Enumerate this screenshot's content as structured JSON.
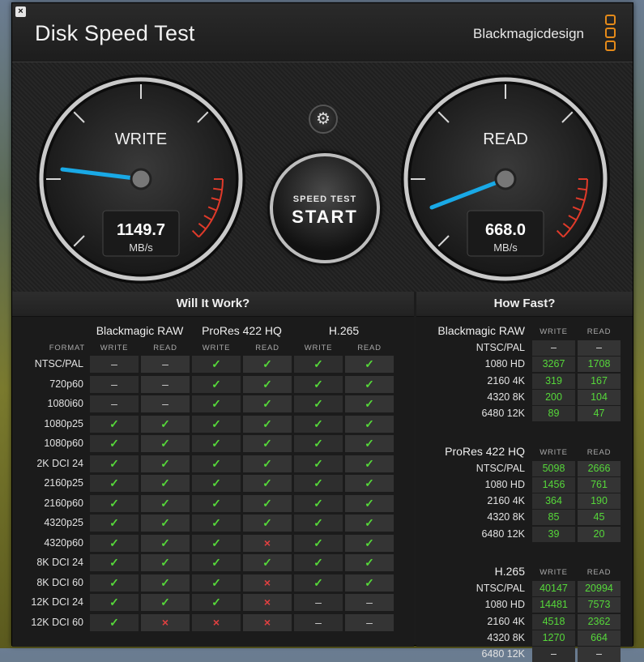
{
  "window": {
    "title": "Disk Speed Test",
    "brand": "Blackmagicdesign",
    "close_glyph": "×"
  },
  "write_gauge": {
    "label": "WRITE",
    "value": "1149.7",
    "unit": "MB/s"
  },
  "read_gauge": {
    "label": "READ",
    "value": "668.0",
    "unit": "MB/s"
  },
  "start_button": {
    "subtitle": "SPEED TEST",
    "label": "START"
  },
  "settings_icon": "gear-icon",
  "will_it_work": {
    "title": "Will It Work?",
    "format_label": "FORMAT",
    "write_label": "WRITE",
    "read_label": "READ",
    "groups": [
      "Blackmagic RAW",
      "ProRes 422 HQ",
      "H.265"
    ],
    "rows": [
      {
        "format": "NTSC/PAL",
        "marks": [
          "–",
          "–",
          "✓",
          "✓",
          "✓",
          "✓"
        ]
      },
      {
        "format": "720p60",
        "marks": [
          "–",
          "–",
          "✓",
          "✓",
          "✓",
          "✓"
        ]
      },
      {
        "format": "1080i60",
        "marks": [
          "–",
          "–",
          "✓",
          "✓",
          "✓",
          "✓"
        ]
      },
      {
        "format": "1080p25",
        "marks": [
          "✓",
          "✓",
          "✓",
          "✓",
          "✓",
          "✓"
        ]
      },
      {
        "format": "1080p60",
        "marks": [
          "✓",
          "✓",
          "✓",
          "✓",
          "✓",
          "✓"
        ]
      },
      {
        "format": "2K DCI 24",
        "marks": [
          "✓",
          "✓",
          "✓",
          "✓",
          "✓",
          "✓"
        ]
      },
      {
        "format": "2160p25",
        "marks": [
          "✓",
          "✓",
          "✓",
          "✓",
          "✓",
          "✓"
        ]
      },
      {
        "format": "2160p60",
        "marks": [
          "✓",
          "✓",
          "✓",
          "✓",
          "✓",
          "✓"
        ]
      },
      {
        "format": "4320p25",
        "marks": [
          "✓",
          "✓",
          "✓",
          "✓",
          "✓",
          "✓"
        ]
      },
      {
        "format": "4320p60",
        "marks": [
          "✓",
          "✓",
          "✓",
          "×",
          "✓",
          "✓"
        ]
      },
      {
        "format": "8K DCI 24",
        "marks": [
          "✓",
          "✓",
          "✓",
          "✓",
          "✓",
          "✓"
        ]
      },
      {
        "format": "8K DCI 60",
        "marks": [
          "✓",
          "✓",
          "✓",
          "×",
          "✓",
          "✓"
        ]
      },
      {
        "format": "12K DCI 24",
        "marks": [
          "✓",
          "✓",
          "✓",
          "×",
          "–",
          "–"
        ]
      },
      {
        "format": "12K DCI 60",
        "marks": [
          "✓",
          "×",
          "×",
          "×",
          "–",
          "–"
        ]
      }
    ]
  },
  "how_fast": {
    "title": "How Fast?",
    "write_label": "WRITE",
    "read_label": "READ",
    "groups": [
      {
        "name": "Blackmagic RAW",
        "rows": [
          {
            "format": "NTSC/PAL",
            "write": "–",
            "read": "–"
          },
          {
            "format": "1080 HD",
            "write": "3267",
            "read": "1708"
          },
          {
            "format": "2160 4K",
            "write": "319",
            "read": "167"
          },
          {
            "format": "4320 8K",
            "write": "200",
            "read": "104"
          },
          {
            "format": "6480 12K",
            "write": "89",
            "read": "47"
          }
        ]
      },
      {
        "name": "ProRes 422 HQ",
        "rows": [
          {
            "format": "NTSC/PAL",
            "write": "5098",
            "read": "2666"
          },
          {
            "format": "1080 HD",
            "write": "1456",
            "read": "761"
          },
          {
            "format": "2160 4K",
            "write": "364",
            "read": "190"
          },
          {
            "format": "4320 8K",
            "write": "85",
            "read": "45"
          },
          {
            "format": "6480 12K",
            "write": "39",
            "read": "20"
          }
        ]
      },
      {
        "name": "H.265",
        "rows": [
          {
            "format": "NTSC/PAL",
            "write": "40147",
            "read": "20994"
          },
          {
            "format": "1080 HD",
            "write": "14481",
            "read": "7573"
          },
          {
            "format": "2160 4K",
            "write": "4518",
            "read": "2362"
          },
          {
            "format": "4320 8K",
            "write": "1270",
            "read": "664"
          },
          {
            "format": "6480 12K",
            "write": "–",
            "read": "–"
          }
        ]
      }
    ]
  },
  "colors": {
    "check": "#56d83a",
    "cross": "#e04040",
    "needle": "#19a9e6",
    "redline": "#e03a2a",
    "brand_accent": "#e58a19"
  }
}
